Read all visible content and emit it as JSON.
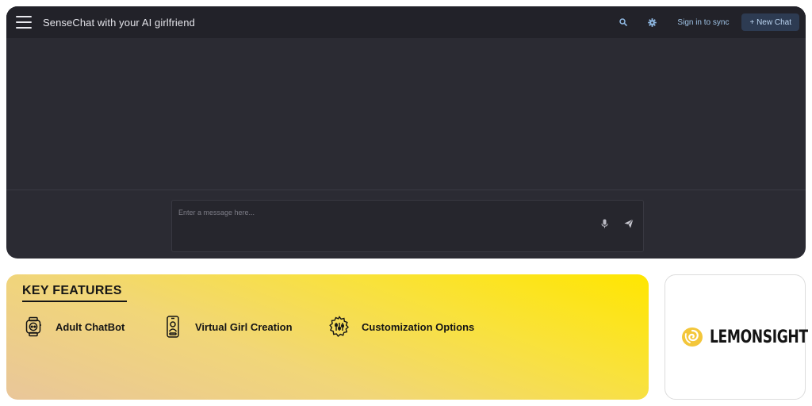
{
  "app": {
    "title": "SenseChat with your AI girlfriend",
    "sign_in_label": "Sign in to sync",
    "new_chat_label": "+ New Chat",
    "icons": {
      "menu": "hamburger-icon",
      "search": "search-icon",
      "settings": "gear-icon"
    }
  },
  "composer": {
    "placeholder": "Enter a message here...",
    "value": "",
    "icons": {
      "mic": "microphone-icon",
      "send": "send-icon"
    }
  },
  "features": {
    "title": "KEY FEATURES",
    "items": [
      {
        "label": "Adult ChatBot",
        "icon": "smartwatch-chat-icon"
      },
      {
        "label": "Virtual Girl Creation",
        "icon": "phone-avatar-icon"
      },
      {
        "label": "Customization Options",
        "icon": "sliders-gear-icon"
      }
    ]
  },
  "sponsor": {
    "name": "LEMONSIGHT",
    "icon": "lemon-swirl-icon"
  },
  "colors": {
    "app_bg": "#2b2b33",
    "topbar_bg": "#222229",
    "accent_link": "#9fc3e6",
    "new_chat_bg": "#2d3b52",
    "banner_yellow": "#ffe600",
    "brand_gold": "#f3c63a"
  }
}
